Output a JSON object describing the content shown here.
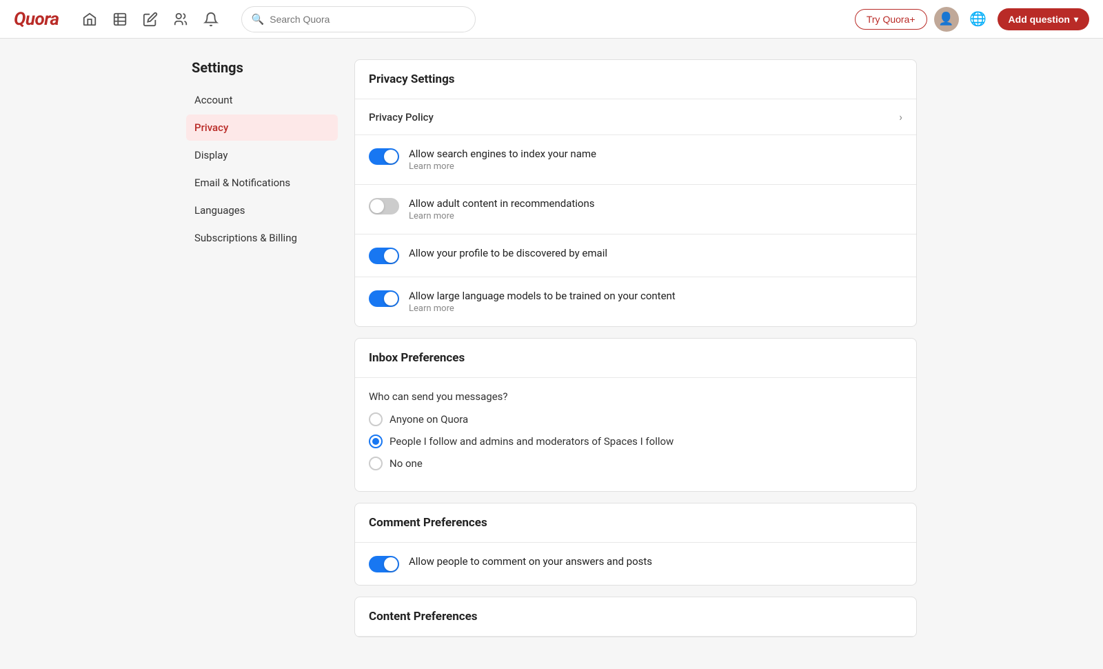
{
  "header": {
    "logo": "Quora",
    "search_placeholder": "Search Quora",
    "try_plus_label": "Try Quora+",
    "add_question_label": "Add question",
    "nav_icons": [
      "home",
      "feed",
      "edit",
      "spaces",
      "notifications"
    ]
  },
  "sidebar": {
    "title": "Settings",
    "items": [
      {
        "id": "account",
        "label": "Account",
        "active": false
      },
      {
        "id": "privacy",
        "label": "Privacy",
        "active": true
      },
      {
        "id": "display",
        "label": "Display",
        "active": false
      },
      {
        "id": "email-notifications",
        "label": "Email & Notifications",
        "active": false
      },
      {
        "id": "languages",
        "label": "Languages",
        "active": false
      },
      {
        "id": "subscriptions-billing",
        "label": "Subscriptions & Billing",
        "active": false
      }
    ]
  },
  "privacy_settings": {
    "card_title": "Privacy Settings",
    "privacy_policy_label": "Privacy Policy",
    "toggles": [
      {
        "id": "search-engines",
        "title": "Allow search engines to index your name",
        "sub": "Learn more",
        "enabled": true
      },
      {
        "id": "adult-content",
        "title": "Allow adult content in recommendations",
        "sub": "Learn more",
        "enabled": false
      },
      {
        "id": "profile-email",
        "title": "Allow your profile to be discovered by email",
        "sub": null,
        "enabled": true
      },
      {
        "id": "llm-training",
        "title": "Allow large language models to be trained on your content",
        "sub": "Learn more",
        "enabled": true
      }
    ]
  },
  "inbox_preferences": {
    "card_title": "Inbox Preferences",
    "question": "Who can send you messages?",
    "options": [
      {
        "id": "anyone",
        "label": "Anyone on Quora",
        "selected": false
      },
      {
        "id": "following",
        "label": "People I follow and admins and moderators of Spaces I follow",
        "selected": true
      },
      {
        "id": "no-one",
        "label": "No one",
        "selected": false
      }
    ]
  },
  "comment_preferences": {
    "card_title": "Comment Preferences",
    "toggle": {
      "id": "allow-comments",
      "title": "Allow people to comment on your answers and posts",
      "enabled": true
    }
  },
  "content_preferences": {
    "card_title": "Content Preferences"
  }
}
